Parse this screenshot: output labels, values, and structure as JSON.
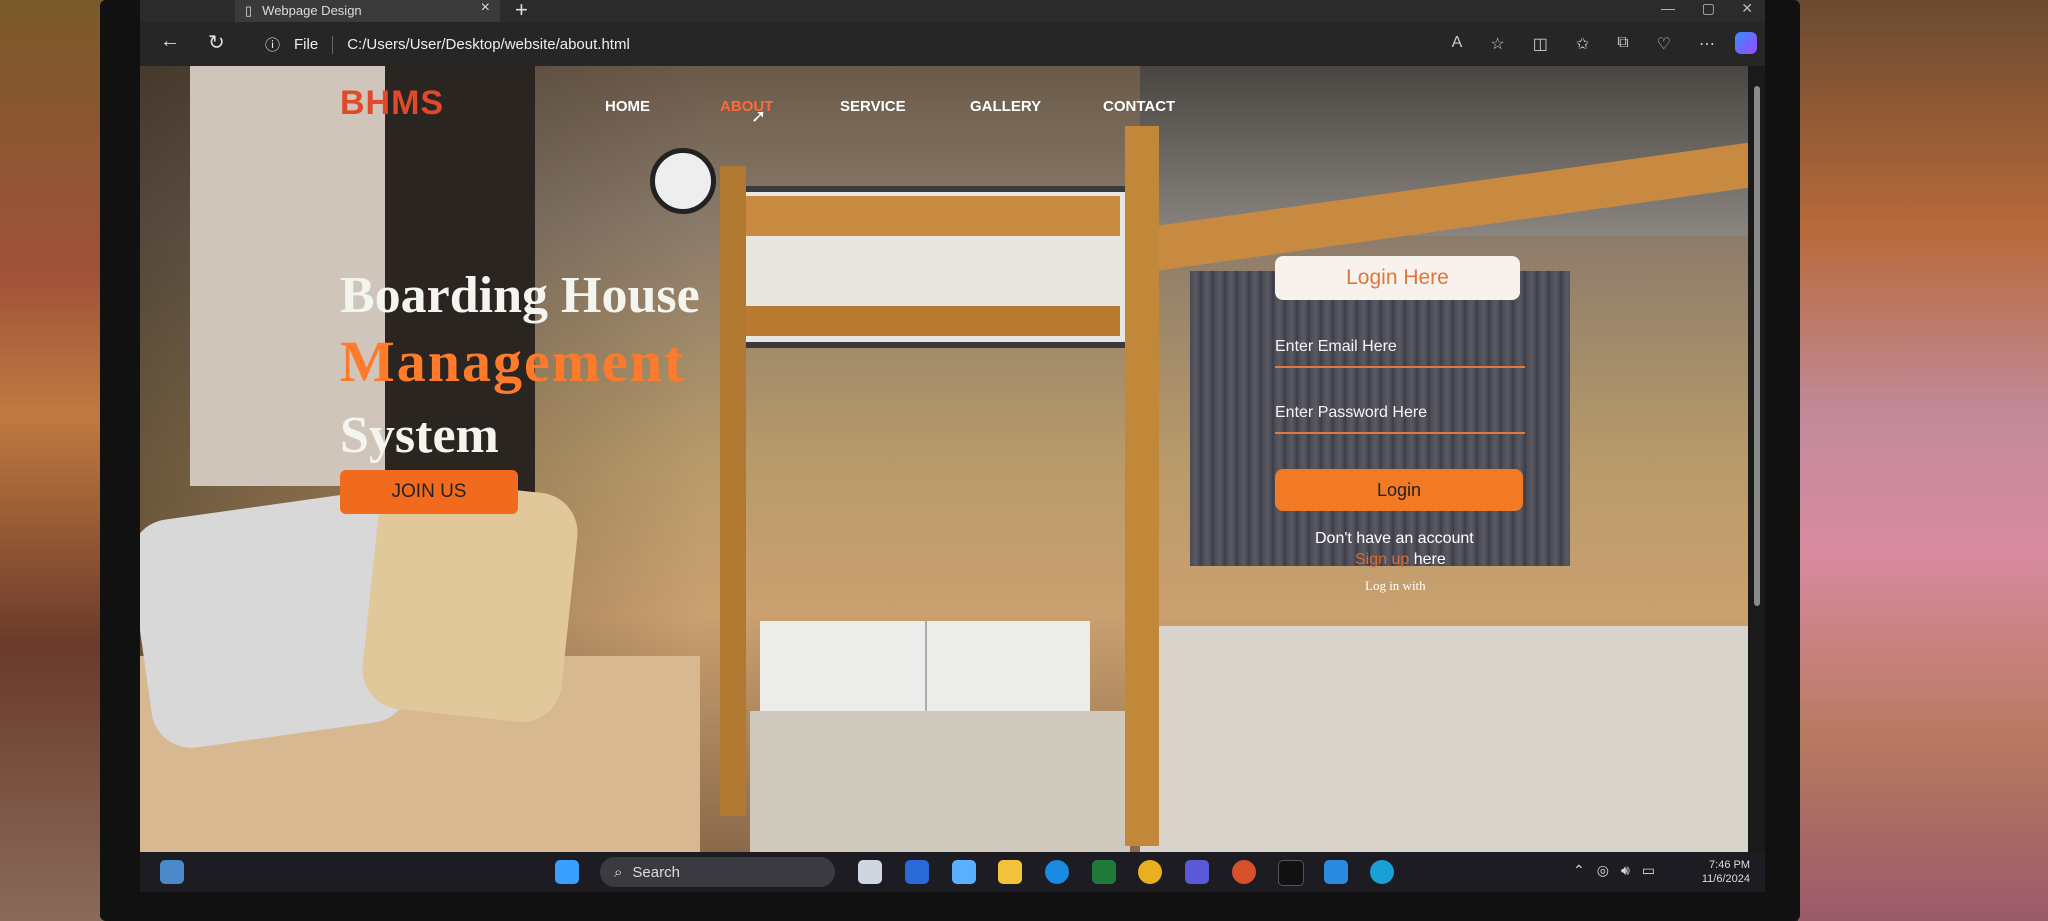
{
  "browser": {
    "tab_title": "Webpage Design",
    "address_scheme": "File",
    "address_url": "C:/Users/User/Desktop/website/about.html"
  },
  "site": {
    "logo": "BHMS",
    "nav": [
      {
        "label": "HOME"
      },
      {
        "label": "ABOUT"
      },
      {
        "label": "SERVICE"
      },
      {
        "label": "GALLERY"
      },
      {
        "label": "CONTACT"
      }
    ],
    "active_nav": "ABOUT"
  },
  "hero": {
    "line1": "Boarding House",
    "line2": "Management",
    "line3": "System",
    "cta": "JOIN US"
  },
  "login": {
    "title": "Login Here",
    "email_placeholder": "Enter Email Here",
    "password_placeholder": "Enter Password Here",
    "button": "Login",
    "no_account": "Don't have an account",
    "signup_link": "Sign up",
    "signup_suffix": " here",
    "log_in_with": "Log in with"
  },
  "taskbar": {
    "search_label": "Search",
    "time": "7:46 PM",
    "date": "11/6/2024"
  },
  "colors": {
    "accent_orange": "#f27a24",
    "logo_red": "#e04a2a"
  }
}
